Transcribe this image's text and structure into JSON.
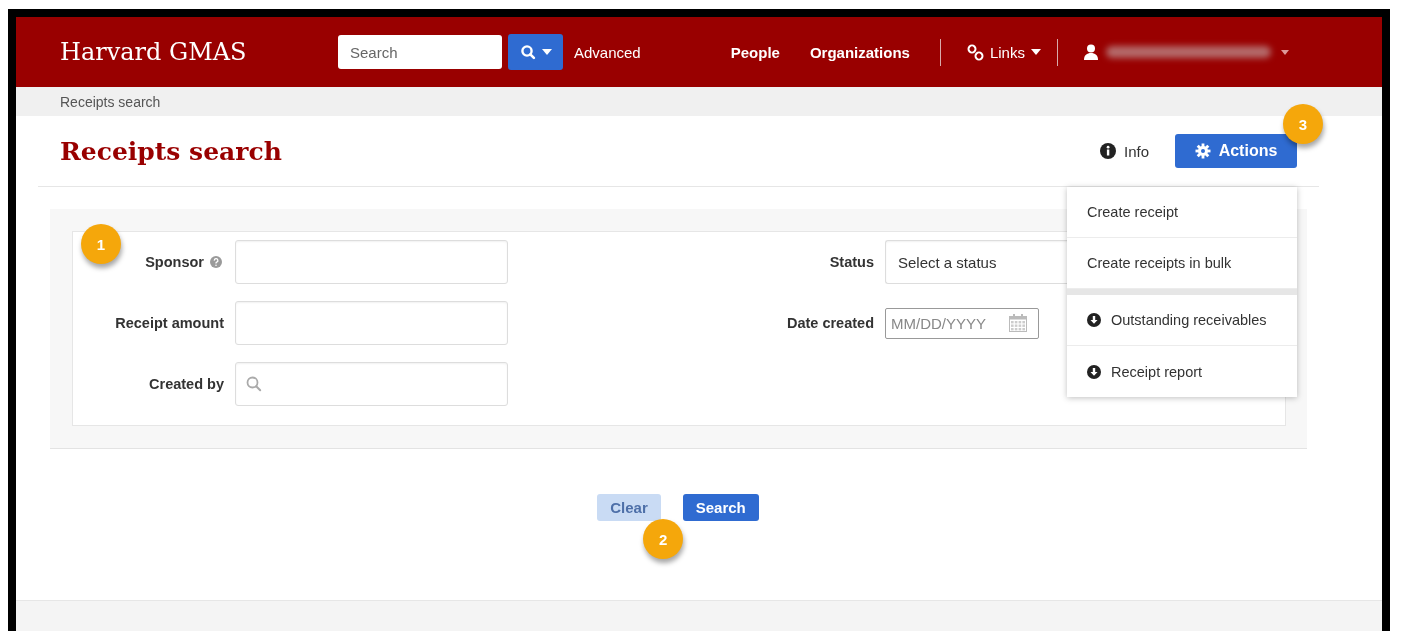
{
  "header": {
    "brand": "Harvard GMAS",
    "search": {
      "placeholder": "Search"
    },
    "advanced_link": "Advanced",
    "nav_links": [
      "People",
      "Organizations"
    ],
    "links_menu": "Links"
  },
  "breadcrumb": "Receipts search",
  "page": {
    "title": "Receipts search",
    "info_link": "Info",
    "actions_button": "Actions"
  },
  "actions_menu": {
    "groups": [
      [
        {
          "label": "Create receipt",
          "kind": "plain"
        },
        {
          "label": "Create receipts in bulk",
          "kind": "plain"
        }
      ],
      [
        {
          "label": "Outstanding receivables",
          "kind": "download"
        },
        {
          "label": "Receipt report",
          "kind": "download"
        }
      ]
    ]
  },
  "form": {
    "left_fields": [
      {
        "label": "Sponsor",
        "kind": "text",
        "help": true
      },
      {
        "label": "Receipt amount",
        "kind": "text",
        "help": false
      },
      {
        "label": "Created by",
        "kind": "lookup",
        "help": false
      }
    ],
    "right_fields": [
      {
        "label": "Status",
        "kind": "select",
        "placeholder": "Select a status"
      },
      {
        "label": "Date created",
        "kind": "date",
        "placeholder": "MM/DD/YYYY"
      }
    ]
  },
  "buttons": [
    {
      "label": "Clear",
      "kind": "secondary"
    },
    {
      "label": "Search",
      "kind": "primary"
    }
  ],
  "callouts": [
    "1",
    "2",
    "3"
  ]
}
